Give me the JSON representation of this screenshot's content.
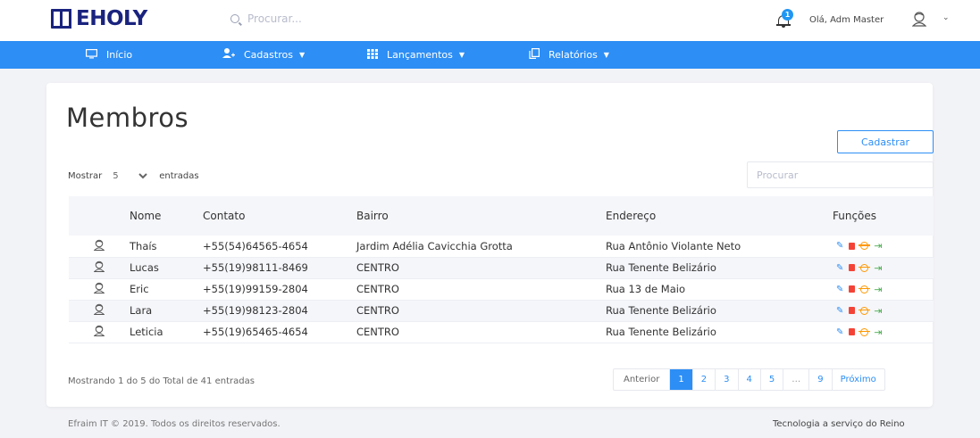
{
  "brand": {
    "name": "EHOLY"
  },
  "search": {
    "placeholder": "Procurar..."
  },
  "notifications": {
    "count": "1"
  },
  "user": {
    "greeting": "Olá, Adm Master"
  },
  "nav": [
    {
      "label": "Início",
      "icon": "monitor-icon",
      "has_dropdown": false
    },
    {
      "label": "Cadastros",
      "icon": "add-user-icon",
      "has_dropdown": true
    },
    {
      "label": "Lançamentos",
      "icon": "grid-icon",
      "has_dropdown": true
    },
    {
      "label": "Relatórios",
      "icon": "copy-icon",
      "has_dropdown": true
    }
  ],
  "page": {
    "title": "Membros",
    "add_button": "Cadastrar",
    "length_prefix": "Mostrar",
    "length_value": "5",
    "length_suffix": "entradas",
    "filter_placeholder": "Procurar"
  },
  "table": {
    "columns": [
      "",
      "Nome",
      "Contato",
      "Bairro",
      "Endereço",
      "Funções"
    ],
    "rows": [
      {
        "nome": "Thaís",
        "contato": "+55(54)64565-4654",
        "bairro": "Jardim Adélia Cavicchia Grotta",
        "endereco": "Rua Antônio Violante Neto"
      },
      {
        "nome": "Lucas",
        "contato": "+55(19)98111-8469",
        "bairro": "CENTRO",
        "endereco": "Rua Tenente Belizário"
      },
      {
        "nome": "Eric",
        "contato": "+55(19)99159-2804",
        "bairro": "CENTRO",
        "endereco": "Rua 13 de Maio"
      },
      {
        "nome": "Lara",
        "contato": "+55(19)98123-2804",
        "bairro": "CENTRO",
        "endereco": "Rua Tenente Belizário"
      },
      {
        "nome": "Leticia",
        "contato": "+55(19)65465-4654",
        "bairro": "CENTRO",
        "endereco": "Rua Tenente Belizário"
      }
    ],
    "actions": [
      "edit-user-icon",
      "delete-icon",
      "target-icon",
      "enter-icon"
    ]
  },
  "info": "Mostrando 1 do 5 do Total de 41 entradas",
  "pagination": {
    "previous": "Anterior",
    "pages": [
      "1",
      "2",
      "3",
      "4",
      "5",
      "…",
      "9"
    ],
    "active": "1",
    "next": "Próximo"
  },
  "footer": {
    "left": "Efraim IT © 2019. Todos os direitos reservados.",
    "right": "Tecnologia a serviço do Reino"
  },
  "colors": {
    "primary": "#2d8ef5",
    "brand": "#1a237e",
    "delete": "#f44336",
    "target": "#ff9800",
    "enter": "#4caf50"
  }
}
